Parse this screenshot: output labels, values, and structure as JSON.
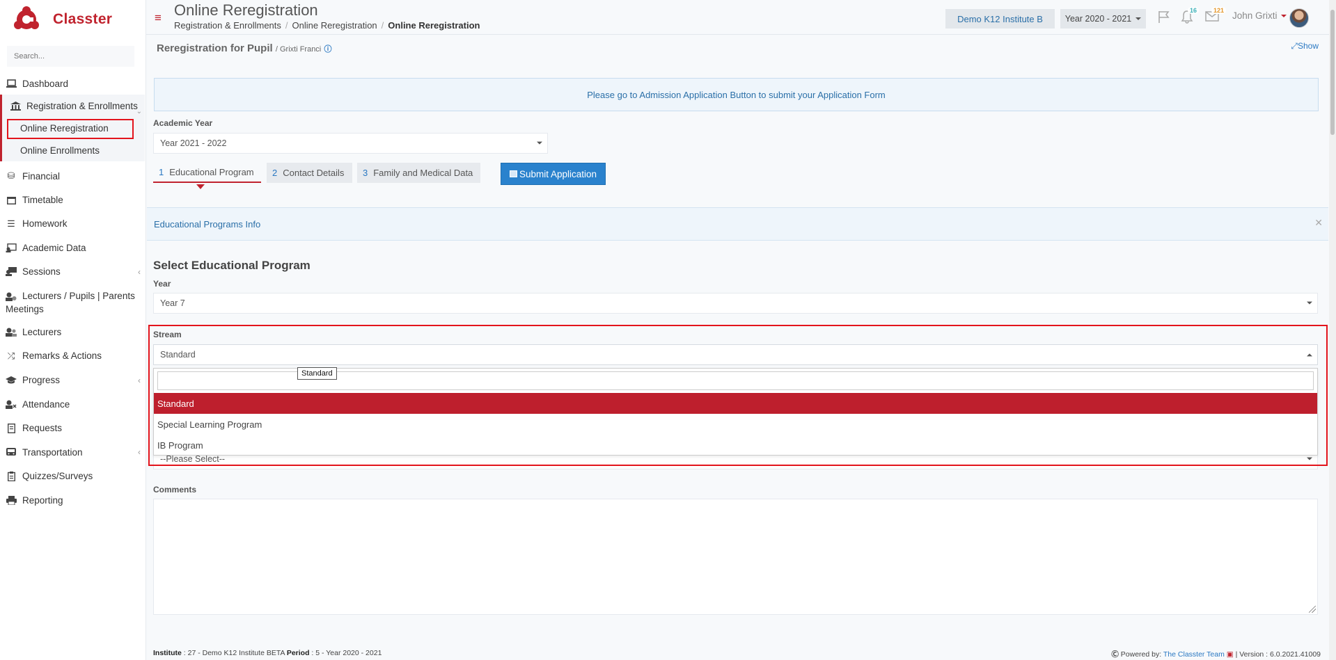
{
  "brand": {
    "name": "Classter",
    "color": "#c0232e"
  },
  "sidebar": {
    "search_placeholder": "Search...",
    "items": [
      {
        "label": "Dashboard",
        "icon": "laptop-icon"
      },
      {
        "label": "Registration & Enrollments",
        "icon": "bank-icon"
      },
      {
        "label": "Financial",
        "icon": "coins-icon"
      },
      {
        "label": "Timetable",
        "icon": "calendar-icon"
      },
      {
        "label": "Homework",
        "icon": "list-icon"
      },
      {
        "label": "Academic Data",
        "icon": "chart-user-icon"
      },
      {
        "label": "Sessions",
        "icon": "sessions-icon"
      },
      {
        "label": "Lecturers / Pupils | Parents Meetings",
        "icon": "meeting-icon"
      },
      {
        "label": "Lecturers",
        "icon": "lecturers-icon"
      },
      {
        "label": "Remarks & Actions",
        "icon": "shuffle-icon"
      },
      {
        "label": "Progress",
        "icon": "graduation-cap-icon"
      },
      {
        "label": "Attendance",
        "icon": "attendance-icon"
      },
      {
        "label": "Requests",
        "icon": "document-icon"
      },
      {
        "label": "Transportation",
        "icon": "bus-icon"
      },
      {
        "label": "Quizzes/Surveys",
        "icon": "clipboard-icon"
      },
      {
        "label": "Reporting",
        "icon": "printer-icon"
      }
    ],
    "sub_items": [
      "Online Reregistration",
      "Online Enrollments"
    ]
  },
  "header": {
    "title": "Online Reregistration",
    "breadcrumb": [
      "Registration & Enrollments",
      "Online Reregistration",
      "Online Reregistration"
    ],
    "institute": "Demo K12 Institute B",
    "year": "Year 2020 - 2021",
    "notifications": "16",
    "messages": "121",
    "user": "John Grixti"
  },
  "panel": {
    "title": "Reregistration for Pupil",
    "pupil": "/ Grixti Franci",
    "info_icon": "ⓘ",
    "show": "Show"
  },
  "alert": "Please go to Admission Application Button to submit your Application Form",
  "academic_year": {
    "label": "Academic Year",
    "value": "Year 2021 - 2022"
  },
  "tabs": [
    {
      "num": "1",
      "label": "Educational Program"
    },
    {
      "num": "2",
      "label": "Contact Details"
    },
    {
      "num": "3",
      "label": "Family and Medical Data"
    }
  ],
  "submit_label": "Submit Application",
  "info_bar": "Educational Programs Info",
  "section_title": "Select Educational Program",
  "year_field": {
    "label": "Year",
    "value": "Year 7"
  },
  "stream_field": {
    "label": "Stream",
    "value": "Standard",
    "options": [
      "Standard",
      "Special Learning Program",
      "IB Program"
    ],
    "tooltip": "Standard"
  },
  "hidden_select_value": "--Please Select--",
  "comments_label": "Comments",
  "footer": {
    "institute_label": "Institute",
    "institute_value": ": 27 - Demo K12 Institute BETA",
    "period_label": "Period",
    "period_value": ": 5 - Year 2020 - 2021",
    "powered": "Powered by:",
    "team": "The Classter Team",
    "version": "| Version : 6.0.2021.41009"
  }
}
